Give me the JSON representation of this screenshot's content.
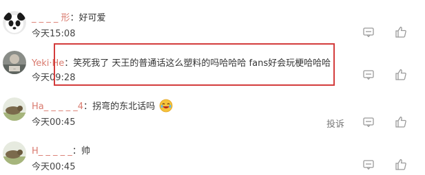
{
  "comments": [
    {
      "name": "_ _ _ _ 形",
      "separator": "：",
      "text": "好可爱",
      "time": "今天15:08"
    },
    {
      "name": "Yeki·He",
      "separator": "：",
      "text": "笑死我了 天王的普通话这么塑料的吗哈哈哈 fans好会玩梗哈哈哈",
      "time": "今天09:28"
    },
    {
      "name": "Ha_ _ _ _ _4",
      "separator": "：",
      "text": "拐弯的东北话吗",
      "emoji": "laughing-crying-emoji",
      "time": "今天00:45",
      "report_label": "投诉"
    },
    {
      "name": "H_ _ _ _ _",
      "separator": "：",
      "text": "帅",
      "time": "今天00:45"
    }
  ],
  "icons": {
    "comment": "comment-icon",
    "like": "thumbs-up-icon"
  },
  "colors": {
    "username": "#d97a6e",
    "highlight": "#d33b3b",
    "icon": "#999999"
  }
}
